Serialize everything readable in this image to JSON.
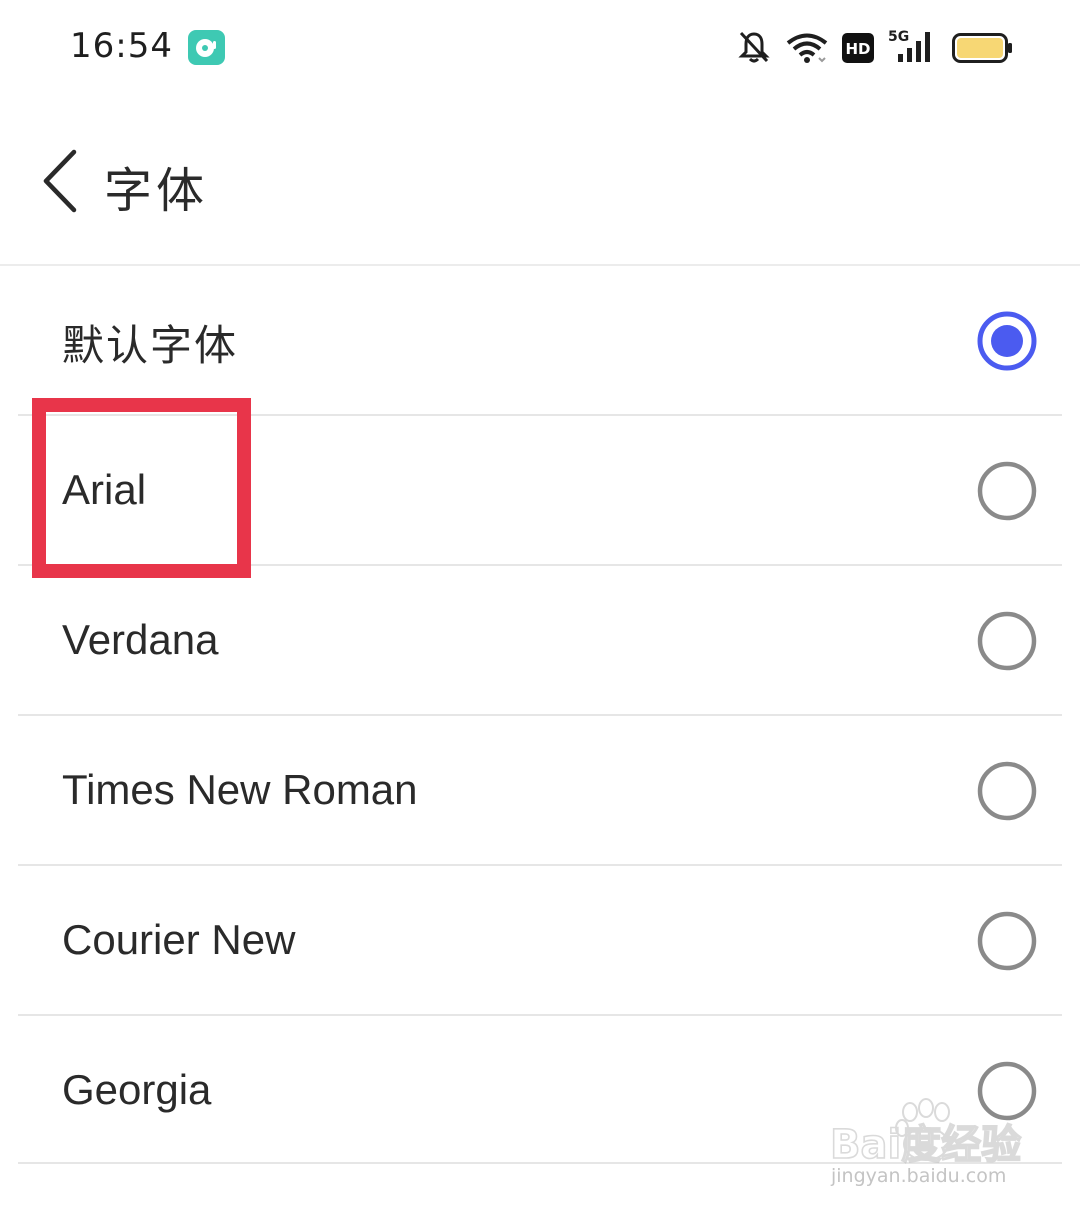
{
  "status_bar": {
    "time": "16:54",
    "icons": [
      "app-notification-icon",
      "mute-icon",
      "wifi-icon",
      "hd-icon",
      "signal-5g-icon",
      "battery-icon"
    ],
    "network_label": "5G",
    "hd_label": "HD"
  },
  "header": {
    "back_icon": "chevron-left-icon",
    "title": "字体"
  },
  "font_options": [
    {
      "label": "默认字体",
      "selected": true
    },
    {
      "label": "Arial",
      "selected": false
    },
    {
      "label": "Verdana",
      "selected": false
    },
    {
      "label": "Times New Roman",
      "selected": false
    },
    {
      "label": "Courier New",
      "selected": false
    },
    {
      "label": "Georgia",
      "selected": false
    }
  ],
  "colors": {
    "accent": "#4b5bf0",
    "highlight": "#e8354a",
    "radio_unselected": "#8a8a8a",
    "battery": "#f7d774",
    "app_icon": "#3ec9b3"
  },
  "watermark": {
    "logo": "Bai度经验",
    "url": "jingyan.baidu.com"
  }
}
